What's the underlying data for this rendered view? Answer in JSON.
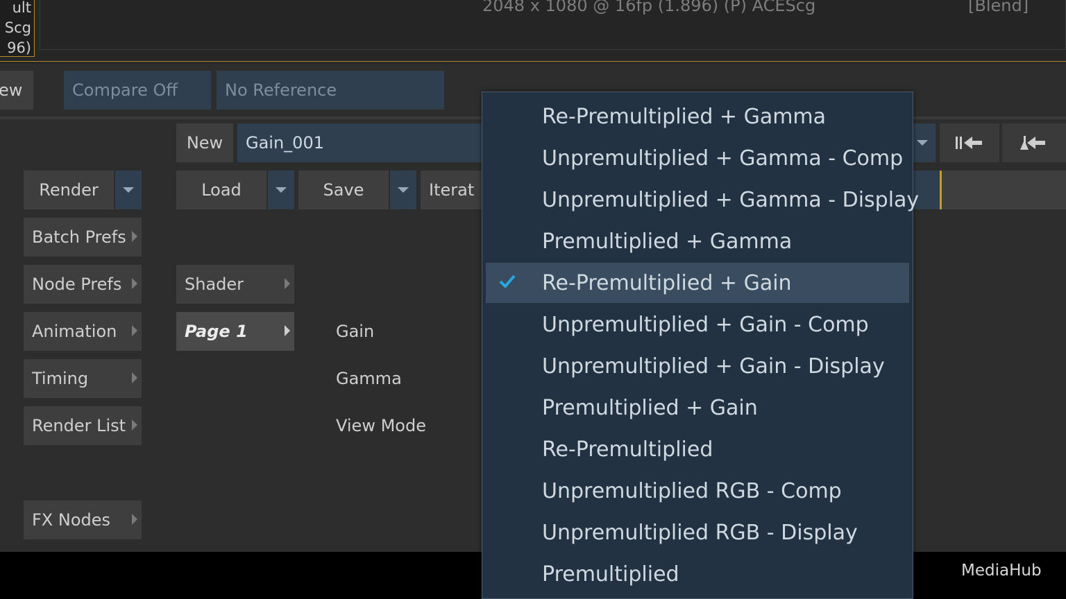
{
  "viewer": {
    "info_lines": [
      "ult",
      "Scg",
      "96)"
    ],
    "resolution": "2048 x 1080 @ 16fp (1.896) (P) ACEScg",
    "mode": "[Blend]"
  },
  "toolbar": {
    "view_label": "ew",
    "compare": "Compare Off",
    "reference": "No Reference"
  },
  "node": {
    "new_label": "New",
    "name": "Gain_001"
  },
  "actions": {
    "render": "Render",
    "load": "Load",
    "save": "Save",
    "iterate": "Iterat"
  },
  "sidebar": {
    "items": [
      {
        "label": "Batch Prefs"
      },
      {
        "label": "Node Prefs"
      },
      {
        "label": "Animation"
      },
      {
        "label": "Timing"
      },
      {
        "label": "Render List"
      },
      {
        "label": "FX Nodes"
      }
    ]
  },
  "pages": {
    "shader": "Shader",
    "page1": "Page 1"
  },
  "params": {
    "gain": "Gain",
    "gamma": "Gamma",
    "view_mode": "View Mode"
  },
  "dropdown": {
    "selected_index": 4,
    "items": [
      "Re-Premultiplied + Gamma",
      "Unpremultiplied + Gamma - Comp",
      "Unpremultiplied + Gamma - Display",
      "Premultiplied + Gamma",
      "Re-Premultiplied + Gain",
      "Unpremultiplied + Gain - Comp",
      "Unpremultiplied + Gain - Display",
      "Premultiplied + Gain",
      "Re-Premultiplied",
      "Unpremultiplied RGB - Comp",
      "Unpremultiplied RGB - Display",
      "Premultiplied"
    ]
  },
  "footer": {
    "mediahub": "MediaHub"
  },
  "colors": {
    "accent": "#b8882f",
    "menu_bg": "#223242",
    "selected_bg": "#3a4d60",
    "check": "#29a8e0"
  }
}
